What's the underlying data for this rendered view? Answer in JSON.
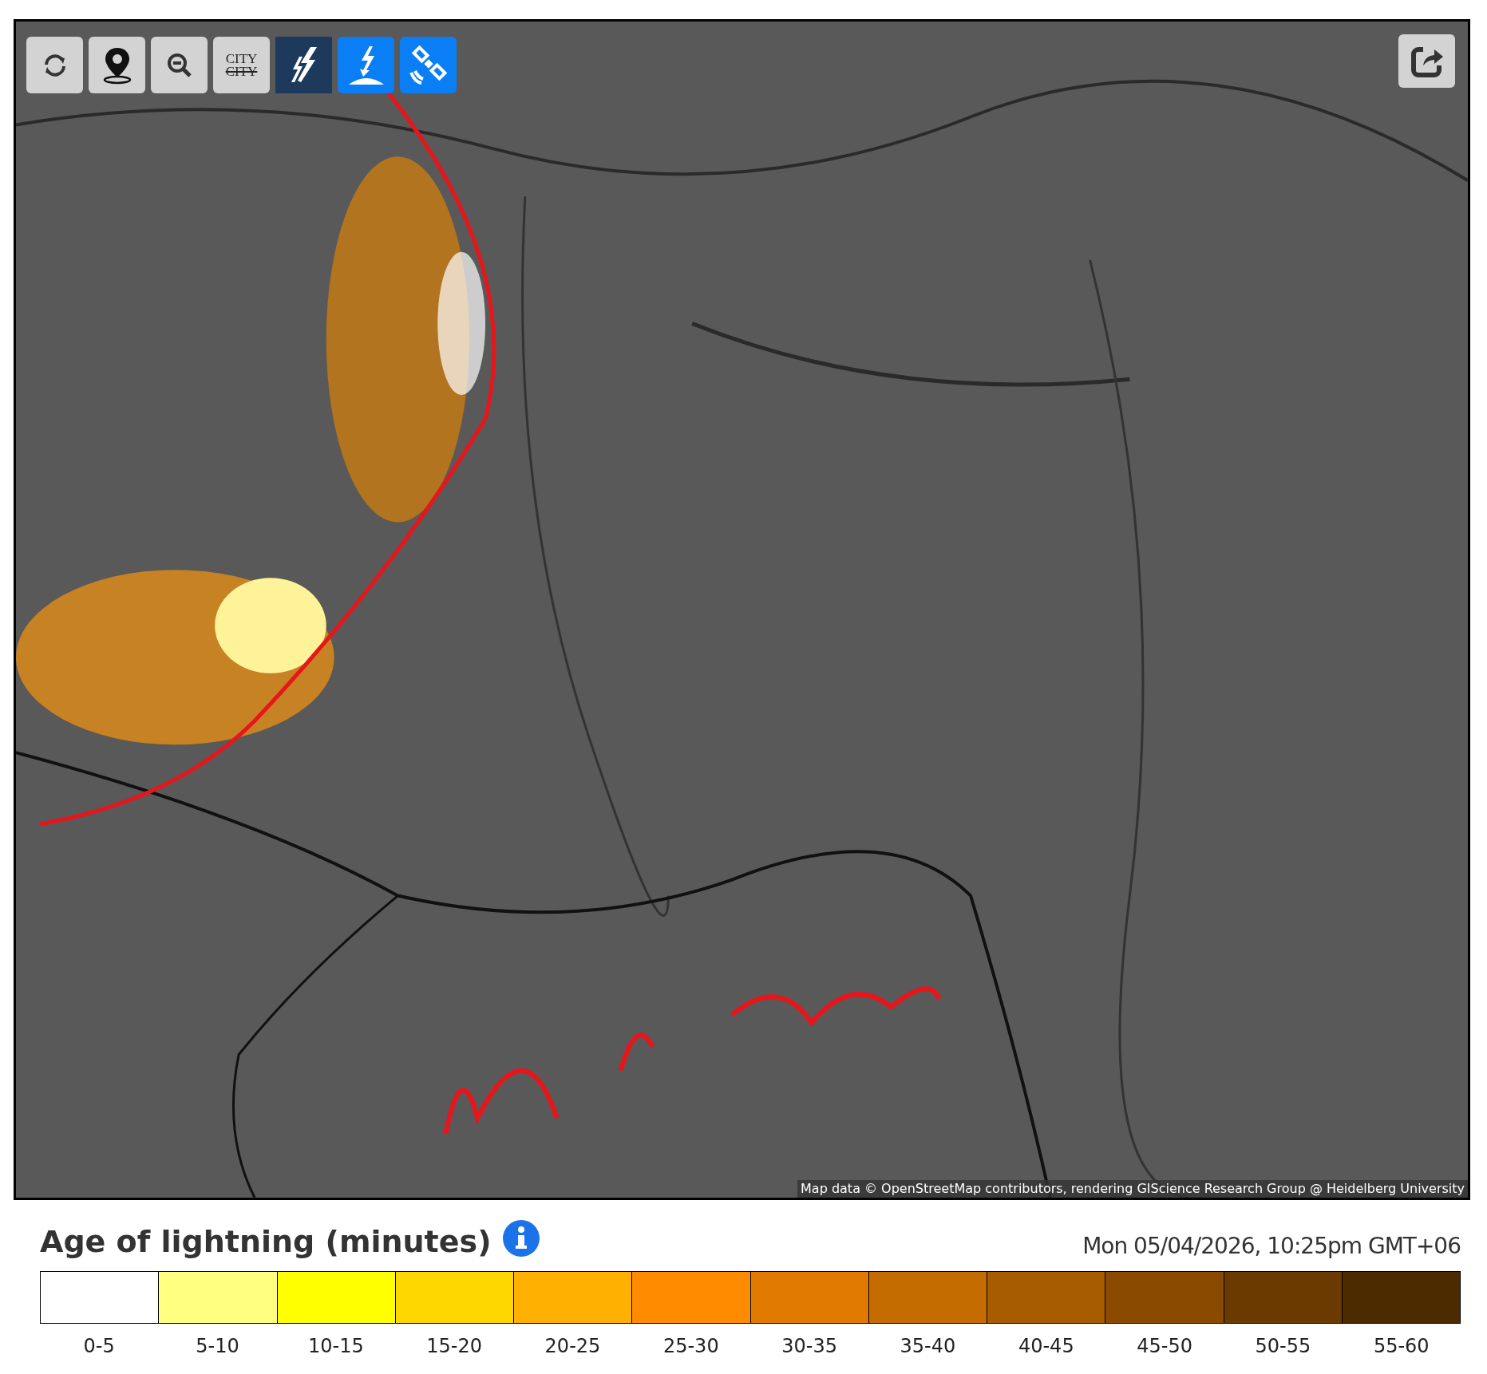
{
  "map": {
    "toolbar": [
      {
        "kind": "refresh"
      },
      {
        "kind": "location"
      },
      {
        "kind": "zoom-out"
      },
      {
        "kind": "city",
        "label": "CITY",
        "struck_label": "CITY"
      },
      {
        "kind": "lightning"
      },
      {
        "kind": "strike"
      },
      {
        "kind": "satellite"
      }
    ],
    "share_button": {
      "kind": "share"
    },
    "attribution": "Map data © OpenStreetMap contributors, rendering GIScience Research Group @ Heidelberg University"
  },
  "legend": {
    "title": "Age of lightning (minutes)",
    "timestamp": "Mon 05/04/2026, 10:25pm GMT+06",
    "bins": [
      {
        "label": "0-5",
        "color": "#ffffff"
      },
      {
        "label": "5-10",
        "color": "#ffff80"
      },
      {
        "label": "10-15",
        "color": "#ffff00"
      },
      {
        "label": "15-20",
        "color": "#ffd700"
      },
      {
        "label": "20-25",
        "color": "#ffb000"
      },
      {
        "label": "25-30",
        "color": "#ff8c00"
      },
      {
        "label": "30-35",
        "color": "#e07a00"
      },
      {
        "label": "35-40",
        "color": "#c46c00"
      },
      {
        "label": "40-45",
        "color": "#a85c00"
      },
      {
        "label": "45-50",
        "color": "#8a4a00"
      },
      {
        "label": "50-55",
        "color": "#6b3a00"
      },
      {
        "label": "55-60",
        "color": "#4d2b00"
      }
    ]
  }
}
